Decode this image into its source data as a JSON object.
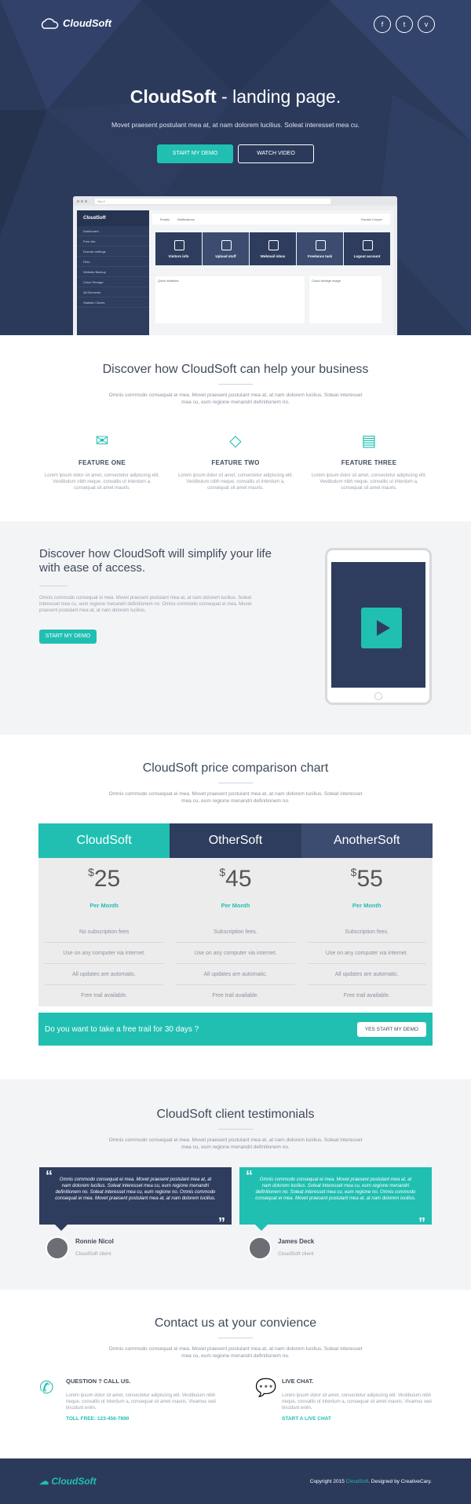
{
  "brand": {
    "name": "CloudSoft",
    "accent": "#20bfb1",
    "navy": "#2b3a5b"
  },
  "hero": {
    "title_bold": "CloudSoft",
    "title_rest": " - landing page.",
    "subtitle": "Movet praesent postulant mea at, at nam dolorem lucilius. Soleat interesset mea cu.",
    "demo_btn": "START MY DEMO",
    "video_btn": "WATCH VIDEO",
    "social": [
      "f",
      "t",
      "v"
    ],
    "app": {
      "url": "http://",
      "tabs": [
        "Emails",
        "Notifications"
      ],
      "user": "Ronald Cooper",
      "side": [
        "Dashboard",
        "Free site",
        "Domain settings",
        "Files",
        "Website Backup",
        "Cloud Storage",
        "All Elements",
        "Statistic Clients"
      ],
      "tiles": [
        "Visitors info",
        "Upload stuff",
        "Webmail inbox",
        "Freelance task",
        "Logout account"
      ],
      "panels": [
        "Quick statistics",
        "Cloud storage usage"
      ]
    }
  },
  "discover": {
    "title": "Discover how CloudSoft can help your business",
    "desc": "Omnis commodo consequat ei mea. Movet praesent postulant mea at, at nam dolorem lucilius. Soleat interesset mea cu, eum regione menandri definitionem no.",
    "features": [
      {
        "icon": "envelope-icon",
        "glyph": "✉",
        "title": "FEATURE ONE",
        "text": "Lorem ipsum dolor sit amet, consectetur adipiscing elit. Vestibulum nibh neque, convallis ut interdum a, consequat sit amet mauris."
      },
      {
        "icon": "diamond-icon",
        "glyph": "◇",
        "title": "FEATURE TWO",
        "text": "Lorem ipsum dolor sit amet, consectetur adipiscing elit. Vestibulum nibh neque, convallis ut interdum a, consequat sit amet mauris."
      },
      {
        "icon": "browser-icon",
        "glyph": "▤",
        "title": "FEATURE THREE",
        "text": "Lorem ipsum dolor sit amet, consectetur adipiscing elit. Vestibulum nibh neque, convallis ut interdum a, consequat sit amet mauris."
      }
    ]
  },
  "ease": {
    "title": "Discover how CloudSoft will simplify your life with ease of access.",
    "text": "Omnis commodo consequat ei mea. Movet praesent postulant mea at, at nam dolorem lucilius. Soleat interesset mea cu, eum regione menandri definitionem no. Omnis commodo consequat ei mea. Movet praesent postulant mea at, at nam dolorem lucilius.",
    "btn": "START MY DEMO"
  },
  "pricing": {
    "title": "CloudSoft price comparison chart",
    "desc": "Omnis commodo consequat ei mea. Movet praesent postulant mea at, at nam dolorem lucilius. Soleat interesset mea cu, eum regione menandri definitionem no.",
    "plans": [
      {
        "name": "CloudSoft",
        "color": "#20bfb1",
        "currency": "$",
        "price": "25",
        "period": "Per Month",
        "rows": [
          "No subscription fees",
          "Use on any computer via internet.",
          "All updates are automatic.",
          "Free trail available."
        ]
      },
      {
        "name": "OtherSoft",
        "color": "#2e3d5e",
        "currency": "$",
        "price": "45",
        "period": "Per Month",
        "rows": [
          "Subscription fees.",
          "Use on any computer via internet.",
          "All updates are automatic.",
          "Free trail available."
        ]
      },
      {
        "name": "AnotherSoft",
        "color": "#3b4c70",
        "currency": "$",
        "price": "55",
        "period": "Per Month",
        "rows": [
          "Subscription fees.",
          "Use on any computer via internet.",
          "All updates are automatic.",
          "Free trail available."
        ]
      }
    ],
    "trial_text": "Do you want to take a free trail for 30 days ?",
    "trial_btn": "YES START MY DEMO"
  },
  "testimonials": {
    "title": "CloudSoft client testimonials",
    "desc": "Omnis commodo consequat ei mea. Movet praesent postulant mea at, at nam dolorem lucilius. Soleat interesset mea cu, eum regione menandri definitionem no.",
    "items": [
      {
        "quote": "Omnis commodo consequat ei mea. Movet praesent postulant mea at, at nam dolorem lucilius. Soleat interesset mea cu, eum regione menandri definitionem no. Soleat interesset mea cu, eum regione no. Omnis commodo consequat ei mea. Movet praesent postulant mea at, at nam dolorem lucilius.",
        "name": "Ronnie Nicol",
        "role": "CloudSoft client",
        "color": "#2e3d5e"
      },
      {
        "quote": "Omnis commodo consequat ei mea. Movet praesent postulant mea at, at nam dolorem lucilius. Soleat interesset mea cu, eum regione menandri definitionem no. Soleat interesset mea cu, eum regione no. Omnis commodo consequat ei mea. Movet praesent postulant mea at, at nam dolorem lucilius.",
        "name": "James Deck",
        "role": "CloudSoft client",
        "color": "#20bfb1"
      }
    ]
  },
  "contact": {
    "title": "Contact us at your convience",
    "desc": "Omnis commodo consequat ei mea. Movet praesent postulant mea at, at nam dolorem lucilius. Soleat interesset mea cu, eum regione menandri definitionem no.",
    "items": [
      {
        "icon": "phone-icon",
        "glyph": "✆",
        "title": "QUESTION ? CALL US.",
        "text": "Lorem ipsum dolor sit amet, consectetur adipiscing elit. Vestibulum nibh neque, convallis ut interdum a, consequat sit amet mauris. Vivamus sed tincidunt enim.",
        "link": "TOLL FREE: 123-456-7890"
      },
      {
        "icon": "chat-icon",
        "glyph": "💬",
        "title": "LIVE CHAT.",
        "text": "Lorem ipsum dolor sit amet, consectetur adipiscing elit. Vestibulum nibh neque, convallis ut interdum a, consequat sit amet mauris. Vivamus sed tincidunt enim.",
        "link": "START A LIVE CHAT"
      }
    ]
  },
  "footer": {
    "logo": "CloudSoft",
    "copy": "Copyright 2015 ",
    "copy_brand": "CloudSoft",
    "copy_tail": ". Designed by CreativeCary."
  }
}
